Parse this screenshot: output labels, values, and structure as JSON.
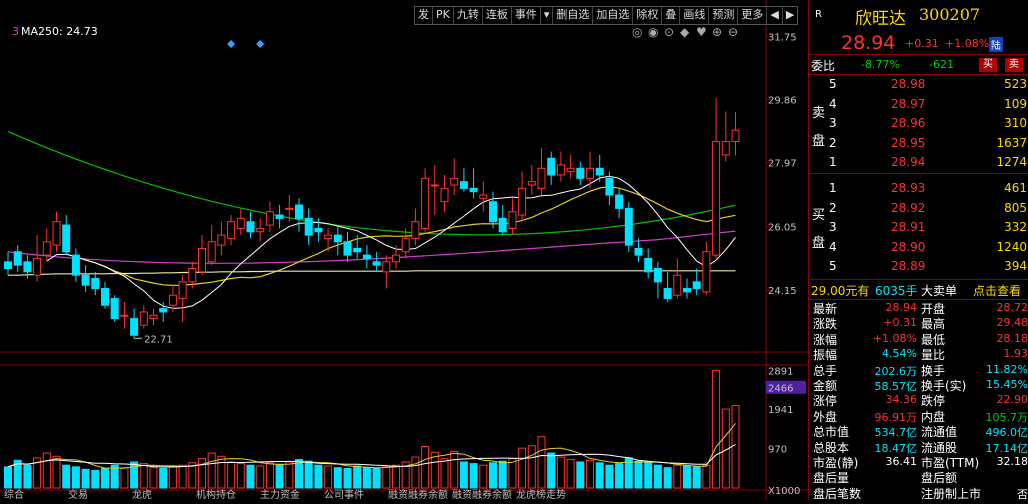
{
  "toolbar": [
    "发",
    "PK",
    "九转",
    "连板",
    "事件",
    "▾",
    "删自选",
    "加自选",
    "除权",
    "叠",
    "画线",
    "预测",
    "更多",
    "◀",
    "▶"
  ],
  "ma_legend": {
    "prefix": "3",
    "label": "MA250: 24.73"
  },
  "price_axis": [
    "31.75",
    "29.86",
    "27.97",
    "26.05",
    "24.15"
  ],
  "low_marker": "22.71",
  "volume_axis": [
    "2891",
    "2466",
    "1941",
    "970",
    "X1000"
  ],
  "volume_axis_highlight": "2466",
  "bottom_tabs": [
    "综合",
    "交易",
    "龙虎",
    "机构持仓",
    "主力资金",
    "公司事件",
    "融资融券余额",
    "融资融券余额",
    "龙虎榜走势"
  ],
  "stock": {
    "badge": "R",
    "name": "欣旺达",
    "code": "300207",
    "price": "28.94",
    "change": "+0.31",
    "change_pct": "+1.08%",
    "tag": "陆"
  },
  "weibi": {
    "label": "委比",
    "pct": "-8.77%",
    "diff": "-621",
    "buy_btn": "买",
    "sell_btn": "卖"
  },
  "sell_side_labels": [
    "卖",
    "盘"
  ],
  "buy_side_labels": [
    "买",
    "盘"
  ],
  "asks": [
    {
      "level": "5",
      "price": "28.98",
      "vol": "523"
    },
    {
      "level": "4",
      "price": "28.97",
      "vol": "109"
    },
    {
      "level": "3",
      "price": "28.96",
      "vol": "310"
    },
    {
      "level": "2",
      "price": "28.95",
      "vol": "1637"
    },
    {
      "level": "1",
      "price": "28.94",
      "vol": "1274"
    }
  ],
  "bids": [
    {
      "level": "1",
      "price": "28.93",
      "vol": "461"
    },
    {
      "level": "2",
      "price": "28.92",
      "vol": "805"
    },
    {
      "level": "3",
      "price": "28.91",
      "vol": "332"
    },
    {
      "level": "4",
      "price": "28.90",
      "vol": "1240"
    },
    {
      "level": "5",
      "price": "28.89",
      "vol": "394"
    }
  ],
  "big_order": {
    "amount": "29.00元有",
    "hands": "6035手",
    "type": "大卖单",
    "link": "点击查看"
  },
  "quote": [
    {
      "l1": "最新",
      "v1": "28.94",
      "l2": "开盘",
      "v2": "28.72"
    },
    {
      "l1": "涨跌",
      "v1": "+0.31",
      "l2": "最高",
      "v2": "29.48"
    },
    {
      "l1": "涨幅",
      "v1": "+1.08%",
      "l2": "最低",
      "v2": "28.18"
    },
    {
      "l1": "振幅",
      "v1": "4.54%",
      "l2": "量比",
      "v2": "1.93"
    },
    {
      "l1": "总手",
      "v1": "202.6万",
      "l2": "换手",
      "v2": "11.82%"
    },
    {
      "l1": "金额",
      "v1": "58.57亿",
      "l2": "换手(实)",
      "v2": "15.45%"
    },
    {
      "l1": "涨停",
      "v1": "34.36",
      "l2": "跌停",
      "v2": "22.90"
    },
    {
      "l1": "外盘",
      "v1": "96.91万",
      "l2": "内盘",
      "v2": "105.7万"
    },
    {
      "l1": "总市值",
      "v1": "534.7亿",
      "l2": "流通值",
      "v2": "496.0亿"
    },
    {
      "l1": "总股本",
      "v1": "18.47亿",
      "l2": "流通股",
      "v2": "17.14亿"
    },
    {
      "l1": "市盈(静)",
      "v1": "36.41",
      "l2": "市盈(TTM)",
      "v2": "32.18"
    },
    {
      "l1": "盘后量",
      "v1": "",
      "l2": "盘后额",
      "v2": ""
    },
    {
      "l1": "盘后笔数",
      "v1": "",
      "l2": "注册制上市",
      "v2": "否"
    }
  ],
  "quote_colors": {
    "v1": [
      "red",
      "red",
      "red",
      "cyan",
      "cyan",
      "cyan",
      "red",
      "red",
      "cyan",
      "cyan",
      "white",
      "white",
      "white"
    ],
    "v2": [
      "red",
      "red",
      "red",
      "red",
      "cyan",
      "cyan",
      "red",
      "green",
      "cyan",
      "cyan",
      "white",
      "white",
      "white"
    ]
  },
  "chart_data": {
    "type": "candlestick",
    "price_range": [
      22.3,
      32.0
    ],
    "volume_range": [
      0,
      3000
    ],
    "candles": [
      [
        25.0,
        24.8,
        25.3,
        24.6
      ],
      [
        25.3,
        24.9,
        25.5,
        24.7
      ],
      [
        25.0,
        24.7,
        25.2,
        24.5
      ],
      [
        24.6,
        25.1,
        25.8,
        24.4
      ],
      [
        25.2,
        25.6,
        26.0,
        25.0
      ],
      [
        25.5,
        26.2,
        26.5,
        25.3
      ],
      [
        26.1,
        25.3,
        26.4,
        25.2
      ],
      [
        25.2,
        24.6,
        25.4,
        24.4
      ],
      [
        24.6,
        24.3,
        24.9,
        24.1
      ],
      [
        24.5,
        24.2,
        24.7,
        24.0
      ],
      [
        24.2,
        23.7,
        24.4,
        23.6
      ],
      [
        23.9,
        23.3,
        24.0,
        23.2
      ],
      [
        23.4,
        23.4,
        23.8,
        23.0
      ],
      [
        23.3,
        22.8,
        23.6,
        22.71
      ],
      [
        23.1,
        23.5,
        23.7,
        23.0
      ],
      [
        23.3,
        23.4,
        23.6,
        23.1
      ],
      [
        23.6,
        23.5,
        23.8,
        23.2
      ],
      [
        23.7,
        24.0,
        24.3,
        23.5
      ],
      [
        23.9,
        24.4,
        24.6,
        23.2
      ],
      [
        24.4,
        24.8,
        25.0,
        24.2
      ],
      [
        24.7,
        25.4,
        25.8,
        24.6
      ],
      [
        25.0,
        25.6,
        26.1,
        24.9
      ],
      [
        25.5,
        25.8,
        26.2,
        25.2
      ],
      [
        25.7,
        26.2,
        26.4,
        25.5
      ],
      [
        26.0,
        26.3,
        26.6,
        25.8
      ],
      [
        26.2,
        25.9,
        26.5,
        25.7
      ],
      [
        25.9,
        26.0,
        26.3,
        25.6
      ],
      [
        26.1,
        26.5,
        26.8,
        25.9
      ],
      [
        26.4,
        26.3,
        26.7,
        26.0
      ],
      [
        26.6,
        26.6,
        27.0,
        26.2
      ],
      [
        26.7,
        26.3,
        26.9,
        25.9
      ],
      [
        26.3,
        25.8,
        26.6,
        25.5
      ],
      [
        26.0,
        25.9,
        26.3,
        25.6
      ],
      [
        25.7,
        25.8,
        26.0,
        25.3
      ],
      [
        25.8,
        25.6,
        26.1,
        25.2
      ],
      [
        25.6,
        25.2,
        25.9,
        25.0
      ],
      [
        25.4,
        25.3,
        25.8,
        25.1
      ],
      [
        25.2,
        25.1,
        25.5,
        24.8
      ],
      [
        25.0,
        24.9,
        25.3,
        24.7
      ],
      [
        24.7,
        25.0,
        25.2,
        24.2
      ],
      [
        25.0,
        25.2,
        25.5,
        24.8
      ],
      [
        25.3,
        25.7,
        26.0,
        25.1
      ],
      [
        25.7,
        26.2,
        26.6,
        25.5
      ],
      [
        26.0,
        27.5,
        27.8,
        25.9
      ],
      [
        27.3,
        27.3,
        27.9,
        26.4
      ],
      [
        26.8,
        27.2,
        27.6,
        26.5
      ],
      [
        27.3,
        27.5,
        28.1,
        27.0
      ],
      [
        27.4,
        27.2,
        27.8,
        27.1
      ],
      [
        27.2,
        27.1,
        27.8,
        26.9
      ],
      [
        26.9,
        27.0,
        27.4,
        26.5
      ],
      [
        26.8,
        26.2,
        27.1,
        26.0
      ],
      [
        26.3,
        25.9,
        26.7,
        25.8
      ],
      [
        26.0,
        26.5,
        26.9,
        25.8
      ],
      [
        26.4,
        27.2,
        27.7,
        26.2
      ],
      [
        27.3,
        27.4,
        27.9,
        27.0
      ],
      [
        27.2,
        27.8,
        28.4,
        27.0
      ],
      [
        28.1,
        27.6,
        28.3,
        27.3
      ],
      [
        27.6,
        27.9,
        28.3,
        27.4
      ],
      [
        27.7,
        27.8,
        28.2,
        27.5
      ],
      [
        27.8,
        27.5,
        28.0,
        27.3
      ],
      [
        27.5,
        27.8,
        28.3,
        27.2
      ],
      [
        27.8,
        27.6,
        28.2,
        27.4
      ],
      [
        27.5,
        27.0,
        27.7,
        26.7
      ],
      [
        27.0,
        26.6,
        27.2,
        26.3
      ],
      [
        26.6,
        25.5,
        26.8,
        25.3
      ],
      [
        25.4,
        25.2,
        25.7,
        25.0
      ],
      [
        25.1,
        24.7,
        25.4,
        24.5
      ],
      [
        24.8,
        24.4,
        25.0,
        23.9
      ],
      [
        24.2,
        23.9,
        24.7,
        23.8
      ],
      [
        24.0,
        24.6,
        25.1,
        23.9
      ],
      [
        24.2,
        24.1,
        24.5,
        23.9
      ],
      [
        24.4,
        24.2,
        24.8,
        24.0
      ],
      [
        24.1,
        25.3,
        25.6,
        24.0
      ],
      [
        25.2,
        28.6,
        29.9,
        25.1
      ],
      [
        28.2,
        28.6,
        29.5,
        28.0
      ],
      [
        28.6,
        28.94,
        29.48,
        28.18
      ]
    ],
    "volumes": [
      520,
      680,
      560,
      740,
      860,
      780,
      560,
      520,
      460,
      430,
      480,
      560,
      500,
      640,
      600,
      500,
      480,
      520,
      560,
      620,
      720,
      860,
      780,
      640,
      600,
      560,
      540,
      620,
      580,
      640,
      700,
      660,
      560,
      540,
      500,
      480,
      540,
      500,
      480,
      520,
      560,
      640,
      760,
      1020,
      880,
      720,
      900,
      640,
      600,
      560,
      620,
      660,
      720,
      980,
      1040,
      1260,
      860,
      760,
      700,
      640,
      680,
      620,
      560,
      600,
      740,
      660,
      620,
      560,
      500,
      560,
      540,
      520,
      560,
      2891,
      1941,
      2026
    ],
    "ma250": [
      24.6,
      24.6,
      24.61,
      24.62,
      24.63,
      24.64,
      24.64,
      24.64,
      24.64,
      24.64,
      24.64,
      24.65,
      24.65,
      24.65,
      24.66,
      24.66,
      24.67,
      24.67,
      24.68,
      24.68,
      24.69,
      24.69,
      24.7,
      24.7,
      24.7,
      24.71,
      24.71,
      24.72,
      24.72,
      24.72,
      24.72,
      24.72,
      24.72,
      24.72,
      24.72,
      24.72,
      24.72,
      24.72,
      24.72,
      24.72,
      24.72,
      24.72,
      24.73,
      24.73,
      24.73,
      24.73,
      24.73,
      24.73,
      24.73,
      24.73,
      24.73,
      24.73,
      24.73,
      24.73,
      24.73,
      24.73,
      24.73,
      24.73,
      24.73,
      24.73,
      24.73,
      24.73,
      24.73,
      24.73,
      24.73,
      24.73,
      24.73,
      24.73,
      24.73,
      24.73,
      24.73,
      24.73,
      24.73,
      24.73,
      24.73,
      24.73
    ]
  }
}
